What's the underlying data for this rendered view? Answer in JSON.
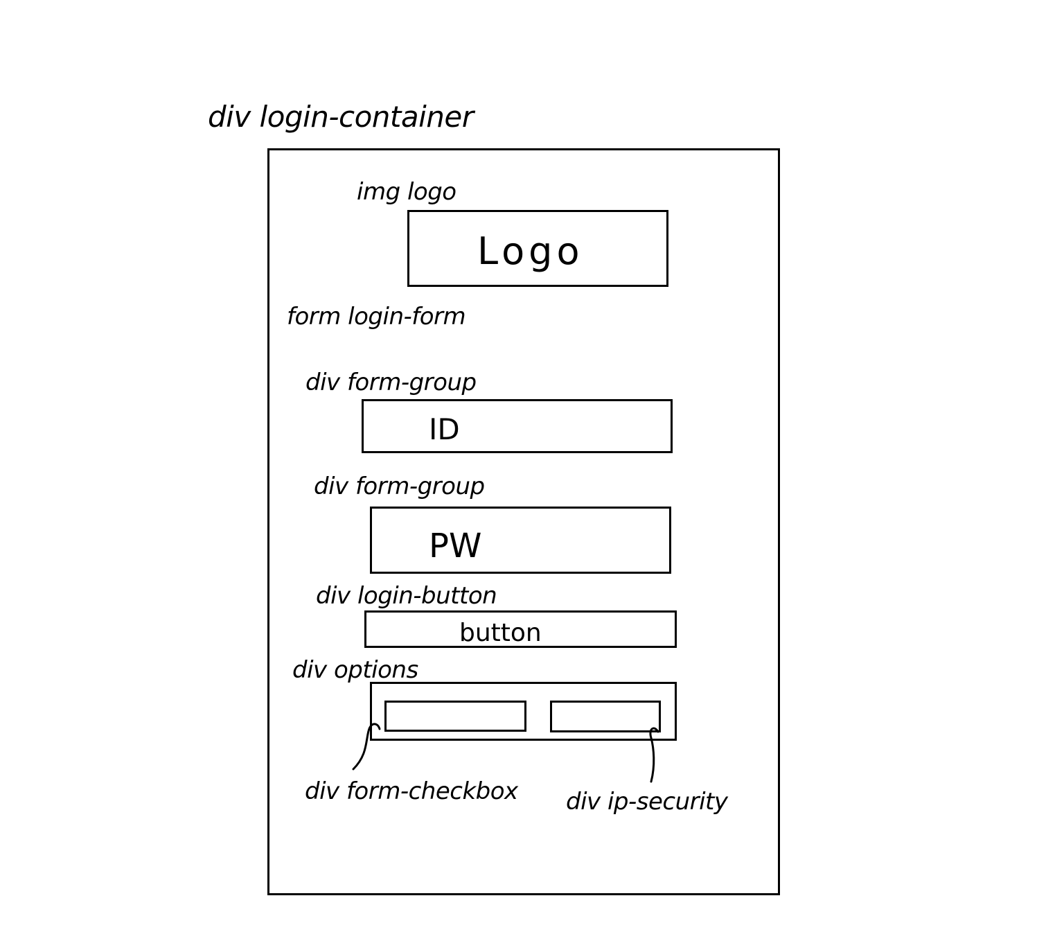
{
  "labels": {
    "login_container": "div login-container",
    "img_logo": "img logo",
    "form_login_form": "form login-form",
    "form_group_1": "div form-group",
    "form_group_2": "div form-group",
    "login_button": "div login-button",
    "options": "div options",
    "form_checkbox": "div form-checkbox",
    "ip_security": "div ip-security"
  },
  "boxes": {
    "logo_text": "Logo",
    "id_text": "ID",
    "pw_text": "PW",
    "button_text": "button"
  }
}
